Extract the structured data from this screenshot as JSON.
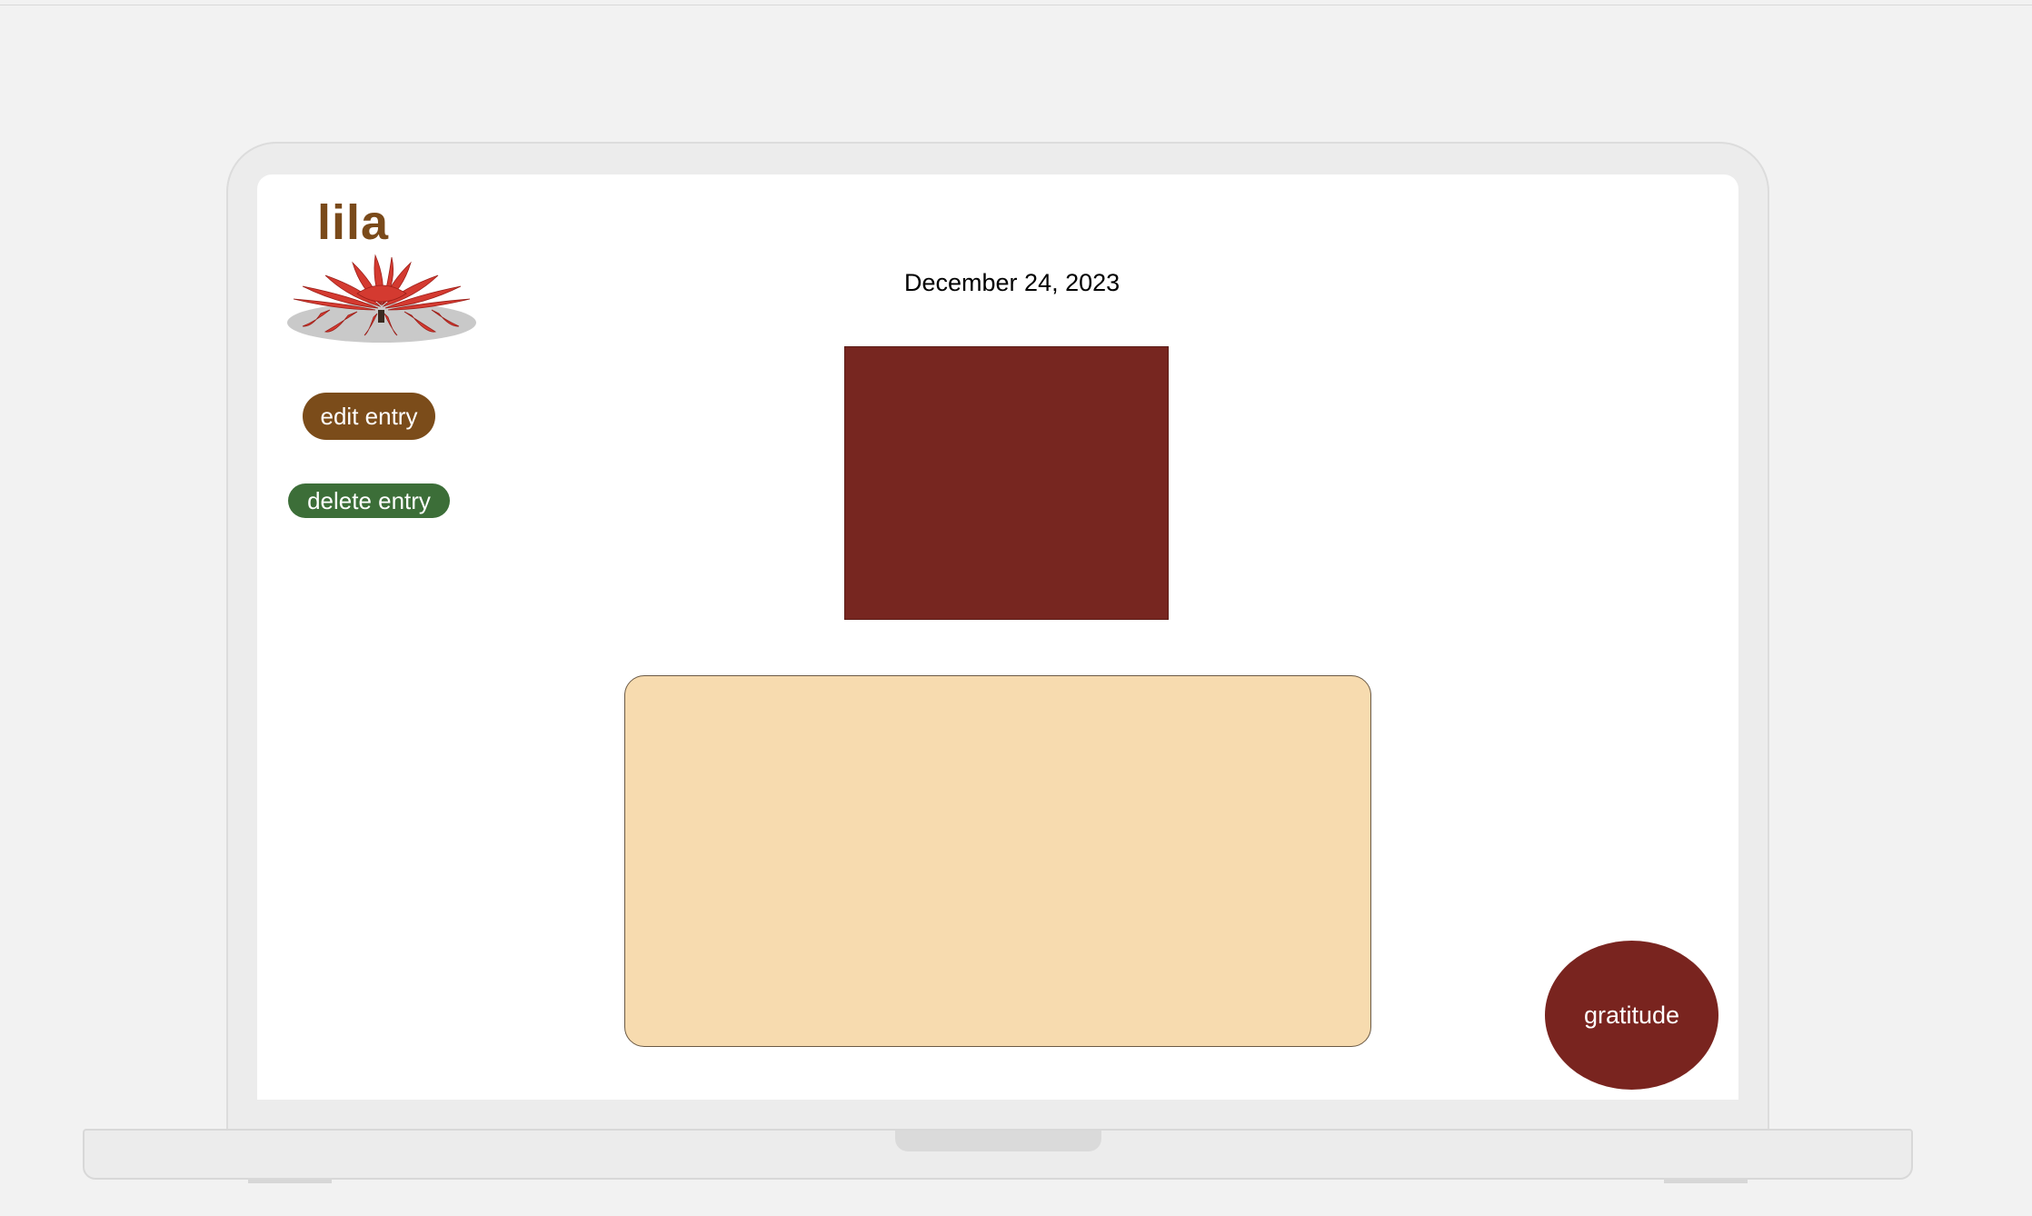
{
  "app": {
    "logo_text": "lila",
    "logo_image": "lotus-flower-icon"
  },
  "sidebar": {
    "edit_label": "edit entry",
    "delete_label": "delete entry"
  },
  "entry": {
    "date": "December 24, 2023",
    "photo_color": "#772620",
    "text_area_color": "#f7dbaf"
  },
  "actions": {
    "gratitude_label": "gratitude"
  },
  "colors": {
    "brand_brown": "#7b4c1a",
    "delete_green": "#3c6e38",
    "accent_red": "#79241f"
  }
}
